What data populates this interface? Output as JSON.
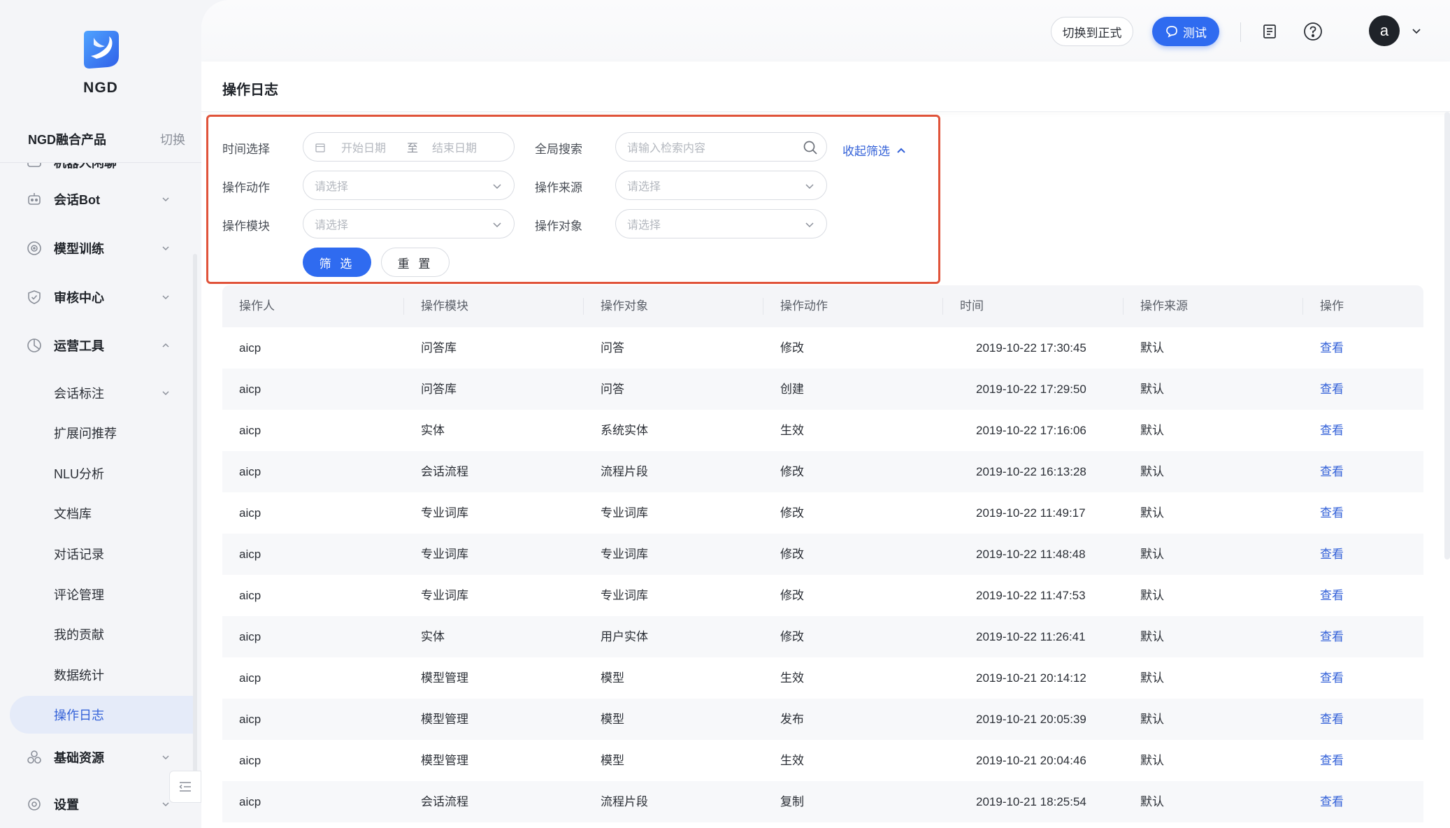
{
  "app": {
    "name": "NGD",
    "product_name": "NGD融合产品",
    "product_switch": "切换"
  },
  "colors": {
    "primary": "#2f6bf0",
    "link": "#3361d8",
    "highlight_border": "#e0533a",
    "sidebar_bg": "#f4f5f8"
  },
  "sidebar": {
    "partial_top_item": "机器人闲聊",
    "groups": [
      {
        "label": "会话Bot",
        "icon": "robot-icon",
        "expanded": false
      },
      {
        "label": "模型训练",
        "icon": "target-icon",
        "expanded": false
      },
      {
        "label": "审核中心",
        "icon": "shield-check-icon",
        "expanded": false
      },
      {
        "label": "运营工具",
        "icon": "pie-chart-icon",
        "expanded": true
      }
    ],
    "sub_items": [
      {
        "label": "会话标注",
        "has_chevron": true
      },
      {
        "label": "扩展问推荐"
      },
      {
        "label": "NLU分析"
      },
      {
        "label": "文档库"
      },
      {
        "label": "对话记录"
      },
      {
        "label": "评论管理"
      },
      {
        "label": "我的贡献"
      },
      {
        "label": "数据统计"
      },
      {
        "label": "操作日志",
        "active": true
      }
    ],
    "bottom_groups": [
      {
        "label": "基础资源",
        "icon": "cubes-icon"
      },
      {
        "label": "设置",
        "icon": "gear-icon"
      }
    ]
  },
  "topbar": {
    "switch_env_label": "切换到正式",
    "test_label": "测试",
    "doc_icon": "document-icon",
    "help_icon": "help-icon",
    "avatar_letter": "a"
  },
  "page": {
    "title": "操作日志"
  },
  "filters": {
    "time_label": "时间选择",
    "start_placeholder": "开始日期",
    "range_sep": "至",
    "end_placeholder": "结束日期",
    "search_label": "全局搜索",
    "search_placeholder": "请输入检索内容",
    "collapse_label": "收起筛选",
    "action_label": "操作动作",
    "action_placeholder": "请选择",
    "source_label": "操作来源",
    "source_placeholder": "请选择",
    "module_label": "操作模块",
    "module_placeholder": "请选择",
    "object_label": "操作对象",
    "object_placeholder": "请选择",
    "filter_button": "筛 选",
    "reset_button": "重 置"
  },
  "table": {
    "columns": [
      "操作人",
      "操作模块",
      "操作对象",
      "操作动作",
      "时间",
      "操作来源",
      "操作"
    ],
    "rows": [
      [
        "aicp",
        "问答库",
        "问答",
        "修改",
        "2019-10-22 17:30:45",
        "默认",
        "查看"
      ],
      [
        "aicp",
        "问答库",
        "问答",
        "创建",
        "2019-10-22 17:29:50",
        "默认",
        "查看"
      ],
      [
        "aicp",
        "实体",
        "系统实体",
        "生效",
        "2019-10-22 17:16:06",
        "默认",
        "查看"
      ],
      [
        "aicp",
        "会话流程",
        "流程片段",
        "修改",
        "2019-10-22 16:13:28",
        "默认",
        "查看"
      ],
      [
        "aicp",
        "专业词库",
        "专业词库",
        "修改",
        "2019-10-22 11:49:17",
        "默认",
        "查看"
      ],
      [
        "aicp",
        "专业词库",
        "专业词库",
        "修改",
        "2019-10-22 11:48:48",
        "默认",
        "查看"
      ],
      [
        "aicp",
        "专业词库",
        "专业词库",
        "修改",
        "2019-10-22 11:47:53",
        "默认",
        "查看"
      ],
      [
        "aicp",
        "实体",
        "用户实体",
        "修改",
        "2019-10-22 11:26:41",
        "默认",
        "查看"
      ],
      [
        "aicp",
        "模型管理",
        "模型",
        "生效",
        "2019-10-21 20:14:12",
        "默认",
        "查看"
      ],
      [
        "aicp",
        "模型管理",
        "模型",
        "发布",
        "2019-10-21 20:05:39",
        "默认",
        "查看"
      ],
      [
        "aicp",
        "模型管理",
        "模型",
        "生效",
        "2019-10-21 20:04:46",
        "默认",
        "查看"
      ],
      [
        "aicp",
        "会话流程",
        "流程片段",
        "复制",
        "2019-10-21 18:25:54",
        "默认",
        "查看"
      ]
    ]
  }
}
